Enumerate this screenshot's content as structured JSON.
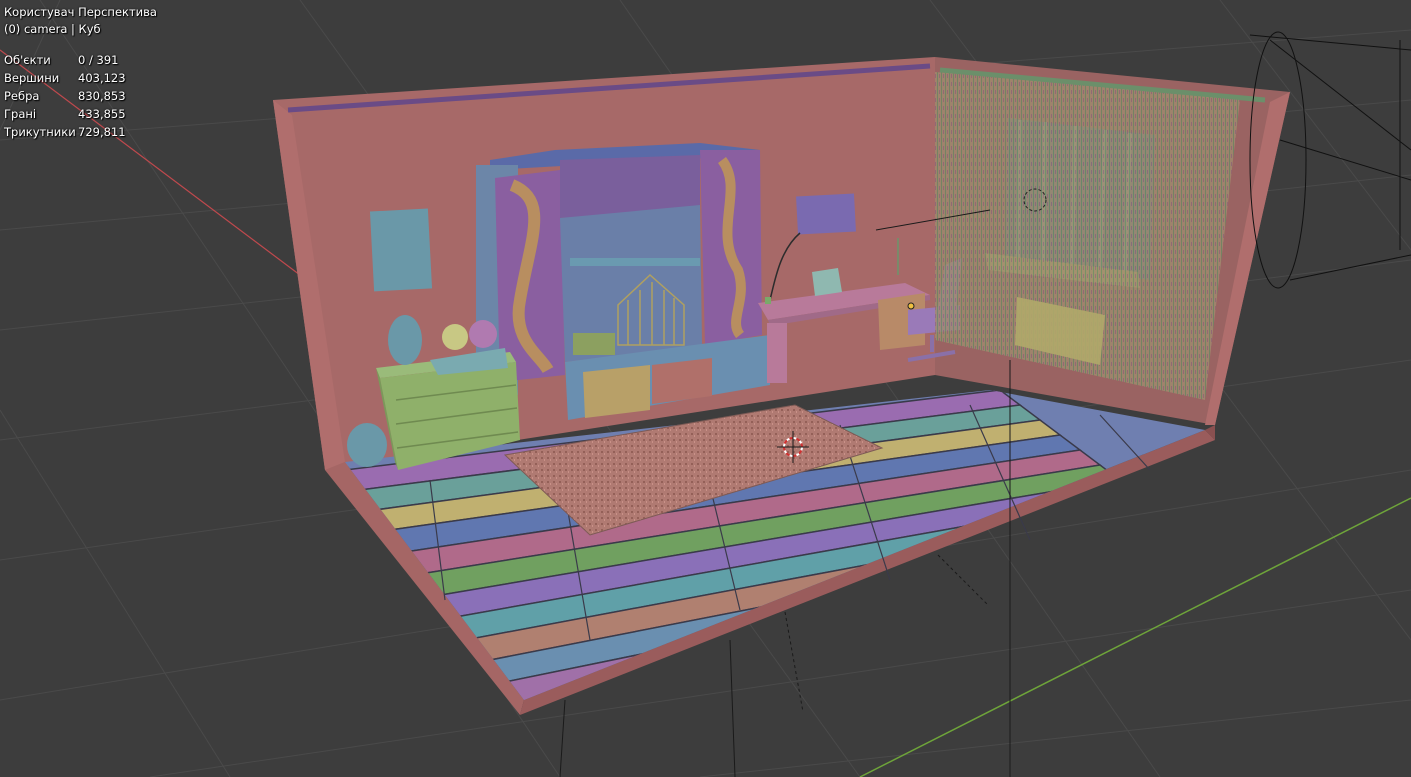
{
  "viewport": {
    "view_name": "Користувач Перспектива",
    "object_info": "(0) camera | Куб"
  },
  "stats": [
    {
      "label": "Об'єкти",
      "value": "0 / 391"
    },
    {
      "label": "Вершини",
      "value": "403,123"
    },
    {
      "label": "Ребра",
      "value": "830,853"
    },
    {
      "label": "Грані",
      "value": "433,855"
    },
    {
      "label": "Трикутники",
      "value": "729,811"
    }
  ],
  "colors": {
    "background": "#3d3d3d",
    "grid": "#4a4a4a",
    "x_axis": "#c0494d",
    "y_axis": "#6ea43a",
    "wall": "#a96a6a",
    "overlay_text": "#ffffff"
  }
}
